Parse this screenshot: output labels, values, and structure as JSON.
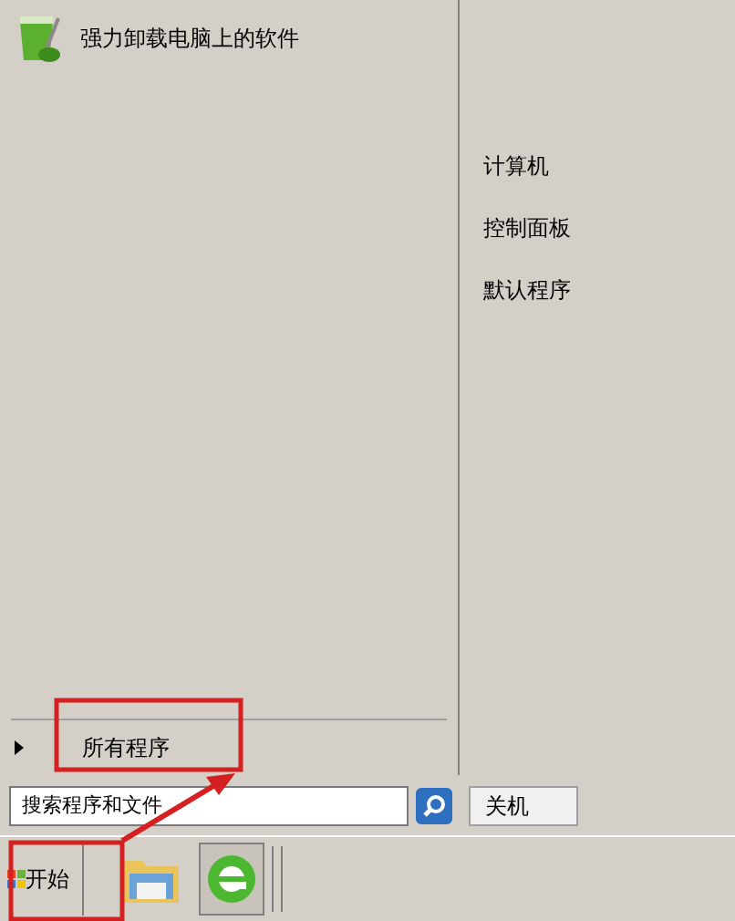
{
  "programs": [
    {
      "label": "强力卸载电脑上的软件"
    }
  ],
  "all_programs": {
    "label": "所有程序"
  },
  "search": {
    "placeholder": "搜索程序和文件"
  },
  "right_items": [
    {
      "label": "计算机"
    },
    {
      "label": "控制面板"
    },
    {
      "label": "默认程序"
    }
  ],
  "shutdown": {
    "label": "关机"
  },
  "taskbar": {
    "start_label": "开始"
  }
}
